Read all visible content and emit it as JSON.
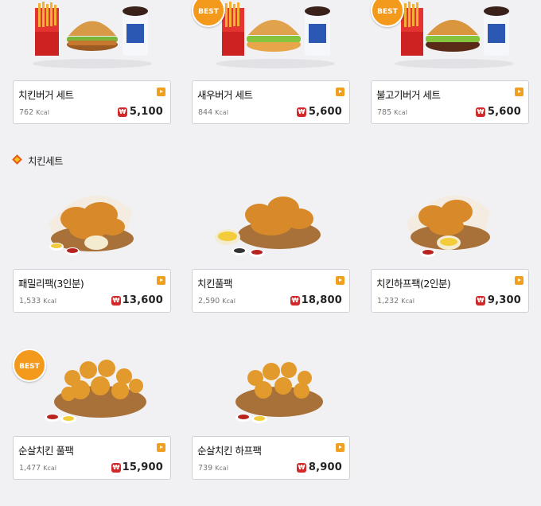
{
  "sections": [
    {
      "title": ""
    },
    {
      "title": "치킨세트"
    }
  ],
  "badges": {
    "best": "BEST"
  },
  "currency_glyph": "₩",
  "kcal_unit": "Kcal",
  "items": [
    {
      "name": "치킨버거 세트",
      "kcal": "762",
      "price": "5,100",
      "best": false,
      "photo": "burger-set"
    },
    {
      "name": "새우버거 세트",
      "kcal": "844",
      "price": "5,600",
      "best": true,
      "photo": "burger-set"
    },
    {
      "name": "불고기버거 세트",
      "kcal": "785",
      "price": "5,600",
      "best": true,
      "photo": "burger-set"
    },
    {
      "name": "패밀리팩(3인분)",
      "kcal": "1,533",
      "price": "13,600",
      "best": false,
      "photo": "chicken-basket"
    },
    {
      "name": "치킨풀팩",
      "kcal": "2,590",
      "price": "18,800",
      "best": false,
      "photo": "chicken-basket"
    },
    {
      "name": "치킨하프팩(2인분)",
      "kcal": "1,232",
      "price": "9,300",
      "best": false,
      "photo": "chicken-basket"
    },
    {
      "name": "순살치킨 풀팩",
      "kcal": "1,477",
      "price": "15,900",
      "best": true,
      "photo": "boneless-basket"
    },
    {
      "name": "순살치킨 하프팩",
      "kcal": "739",
      "price": "8,900",
      "best": false,
      "photo": "boneless-basket"
    }
  ],
  "colors": {
    "accent": "#f0a020",
    "won_badge": "#d22a2a",
    "best_badge": "#f39a1d",
    "background": "#f1f1f4"
  }
}
